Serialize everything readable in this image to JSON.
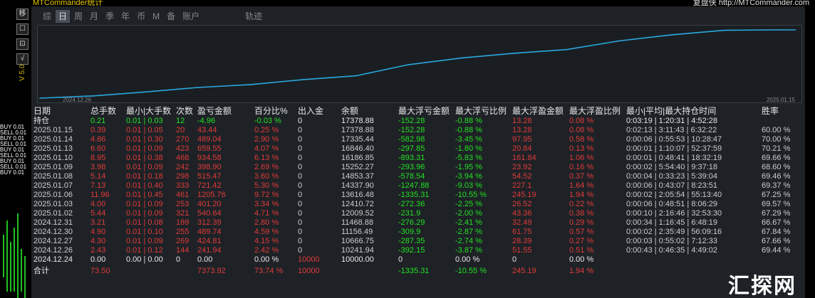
{
  "window": {
    "app_title": "MTCommander统计",
    "copyright": "复盘侠 http://MTCommander.com"
  },
  "left_strip": {
    "version": "V 5.05",
    "ticks": [
      "BUY 0.01",
      "SELL 0.01",
      "BUY 0.01",
      "SELL 0.01",
      "BUY 0.01",
      "SELL 0.01",
      "BUY 0.01",
      "SELL 0.01",
      "BUY 0.01"
    ]
  },
  "side_buttons": [
    {
      "label": "移",
      "name": "move-icon"
    },
    {
      "label": "☐",
      "name": "window-icon"
    },
    {
      "label": "⊡",
      "name": "layout-icon"
    },
    {
      "label": "√",
      "name": "check-icon"
    }
  ],
  "tabs": [
    {
      "label": "综",
      "active": false
    },
    {
      "label": "日",
      "active": true
    },
    {
      "label": "周",
      "active": false
    },
    {
      "label": "月",
      "active": false
    },
    {
      "label": "季",
      "active": false
    },
    {
      "label": "年",
      "active": false
    },
    {
      "label": "币",
      "active": false
    },
    {
      "label": "M",
      "active": false
    },
    {
      "label": "备",
      "active": false
    },
    {
      "label": "账户",
      "active": false
    },
    {
      "label": "轨迹",
      "active": false
    }
  ],
  "chart": {
    "start_date": "2024.12.26",
    "end_date": "2025.01.15",
    "line_color": "#2aa7e0"
  },
  "chart_data": {
    "type": "line",
    "x": [
      "2024.12.24",
      "2024.12.26",
      "2024.12.27",
      "2024.12.30",
      "2024.12.31",
      "2025.01.02",
      "2025.01.03",
      "2025.01.06",
      "2025.01.07",
      "2025.01.08",
      "2025.01.09",
      "2025.01.10",
      "2025.01.13",
      "2025.01.14",
      "2025.01.15"
    ],
    "values": [
      10000.0,
      10241.94,
      10666.75,
      11156.49,
      11468.88,
      12009.52,
      12410.72,
      13616.48,
      14337.9,
      14853.37,
      15252.27,
      16186.85,
      16846.4,
      17335.44,
      17378.88
    ],
    "ylabel": "",
    "xlabel": ""
  },
  "table": {
    "headers": [
      "日期",
      "总手数",
      "最小|大手数",
      "次数",
      "盈亏金额",
      "百分比%",
      "出入金",
      "余额",
      "最大浮亏金额",
      "最大浮亏比例",
      "最大浮盈金额",
      "最大浮盈比例",
      "最小|平均|最大持仓时间",
      "胜率"
    ],
    "holding": {
      "date": "持仓",
      "lots": "0.21",
      "minmax": "0.01 | 0.03",
      "count": "12",
      "pnl": "-4.96",
      "pct": "-0.03 %",
      "inout": "0",
      "balance": "17378.88",
      "mfl": "-152.28",
      "mflp": "-0.88 %",
      "mfp": "13.28",
      "mfpp": "0.08 %",
      "time": "0:03:19 | 1:20:31 | 4:52:28",
      "win": ""
    },
    "rows": [
      {
        "date": "2025.01.15",
        "lots": "0.39",
        "minmax": "0.01 | 0.05",
        "count": "20",
        "pnl": "43.44",
        "pct": "0.25 %",
        "inout": "0",
        "balance": "17378.88",
        "mfl": "-152.28",
        "mflp": "-0.88 %",
        "mfp": "13.28",
        "mfpp": "0.08 %",
        "time": "0:02:13 | 3:11:43 | 6:32:22",
        "win": "60.00 %"
      },
      {
        "date": "2025.01.14",
        "lots": "4.86",
        "minmax": "0.01 | 0.30",
        "count": "270",
        "pnl": "489.04",
        "pct": "2.90 %",
        "inout": "0",
        "balance": "17335.44",
        "mfl": "-582.98",
        "mflp": "-3.45 %",
        "mfp": "97.95",
        "mfpp": "0.58 %",
        "time": "0:00:06 | 0:55:53 | 10:28:47",
        "win": "70.00 %"
      },
      {
        "date": "2025.01.13",
        "lots": "6.60",
        "minmax": "0.01 | 0.09",
        "count": "423",
        "pnl": "659.55",
        "pct": "4.07 %",
        "inout": "0",
        "balance": "16846.40",
        "mfl": "-297.85",
        "mflp": "-1.80 %",
        "mfp": "20.84",
        "mfpp": "0.13 %",
        "time": "0:00:01 | 1:10:07 | 52:37:59",
        "win": "70.21 %"
      },
      {
        "date": "2025.01.10",
        "lots": "8.95",
        "minmax": "0.01 | 0.38",
        "count": "468",
        "pnl": "934.58",
        "pct": "6.13 %",
        "inout": "0",
        "balance": "16186.85",
        "mfl": "-893.31",
        "mflp": "-5.83 %",
        "mfp": "161.84",
        "mfpp": "1.06 %",
        "time": "0:00:01 | 0:48:41 | 18:32:19",
        "win": "69.66 %"
      },
      {
        "date": "2025.01.09",
        "lots": "3.98",
        "minmax": "0.01 | 0.09",
        "count": "242",
        "pnl": "398.90",
        "pct": "2.69 %",
        "inout": "0",
        "balance": "15252.27",
        "mfl": "-293.96",
        "mflp": "-1.95 %",
        "mfp": "23.92",
        "mfpp": "0.16 %",
        "time": "0:00:02 | 5:54:40 | 9:37:18",
        "win": "68.60 %"
      },
      {
        "date": "2025.01.08",
        "lots": "5.14",
        "minmax": "0.01 | 0.18",
        "count": "298",
        "pnl": "515.47",
        "pct": "3.60 %",
        "inout": "0",
        "balance": "14853.37",
        "mfl": "-578.54",
        "mflp": "-3.94 %",
        "mfp": "54.52",
        "mfpp": "0.37 %",
        "time": "0:00:04 | 0:33:23 | 5:39:04",
        "win": "69.46 %"
      },
      {
        "date": "2025.01.07",
        "lots": "7.13",
        "minmax": "0.01 | 0.40",
        "count": "333",
        "pnl": "721.42",
        "pct": "5.30 %",
        "inout": "0",
        "balance": "14337.90",
        "mfl": "-1247.88",
        "mflp": "-9.03 %",
        "mfp": "227.1",
        "mfpp": "1.64 %",
        "time": "0:00:06 | 0:43:07 | 8:23:51",
        "win": "69.37 %"
      },
      {
        "date": "2025.01.06",
        "lots": "11.96",
        "minmax": "0.01 | 0.45",
        "count": "461",
        "pnl": "1205.76",
        "pct": "9.72 %",
        "inout": "0",
        "balance": "13616.48",
        "mfl": "-1335.31",
        "mflp": "-10.55 %",
        "mfp": "245.19",
        "mfpp": "1.94 %",
        "time": "0:00:02 | 2:05:54 | 55:13:40",
        "win": "67.25 %"
      },
      {
        "date": "2025.01.03",
        "lots": "4.00",
        "minmax": "0.01 | 0.09",
        "count": "253",
        "pnl": "401.20",
        "pct": "3.34 %",
        "inout": "0",
        "balance": "12410.72",
        "mfl": "-272.36",
        "mflp": "-2.25 %",
        "mfp": "26.52",
        "mfpp": "0.22 %",
        "time": "0:00:06 | 0:48:51 | 8:06:29",
        "win": "69.57 %"
      },
      {
        "date": "2025.01.02",
        "lots": "5.44",
        "minmax": "0.01 | 0.09",
        "count": "321",
        "pnl": "540.64",
        "pct": "4.71 %",
        "inout": "0",
        "balance": "12009.52",
        "mfl": "-231.9",
        "mflp": "-2.00 %",
        "mfp": "43.36",
        "mfpp": "0.38 %",
        "time": "0:00:10 | 2:16:46 | 32:53:30",
        "win": "67.29 %"
      },
      {
        "date": "2024.12.31",
        "lots": "3.21",
        "minmax": "0.01 | 0.08",
        "count": "189",
        "pnl": "312.39",
        "pct": "2.80 %",
        "inout": "0",
        "balance": "11468.88",
        "mfl": "-276.29",
        "mflp": "-2.41 %",
        "mfp": "32.49",
        "mfpp": "0.29 %",
        "time": "0:00:34 | 1:16:45 | 6:48:19",
        "win": "66.67 %"
      },
      {
        "date": "2024.12.30",
        "lots": "4.90",
        "minmax": "0.01 | 0.10",
        "count": "255",
        "pnl": "489.74",
        "pct": "4.59 %",
        "inout": "0",
        "balance": "11156.49",
        "mfl": "-309.9",
        "mflp": "-2.87 %",
        "mfp": "61.75",
        "mfpp": "0.57 %",
        "time": "0:00:02 | 2:35:49 | 56:09:16",
        "win": "67.84 %"
      },
      {
        "date": "2024.12.27",
        "lots": "4.30",
        "minmax": "0.01 | 0.09",
        "count": "269",
        "pnl": "424.81",
        "pct": "4.15 %",
        "inout": "0",
        "balance": "10666.75",
        "mfl": "-287.35",
        "mflp": "-2.74 %",
        "mfp": "28.39",
        "mfpp": "0.27 %",
        "time": "0:00:03 | 0:55:02 | 7:12:33",
        "win": "67.66 %"
      },
      {
        "date": "2024.12.26",
        "lots": "2.43",
        "minmax": "0.01 | 0.12",
        "count": "144",
        "pnl": "241.94",
        "pct": "2.42 %",
        "inout": "0",
        "balance": "10241.94",
        "mfl": "-392.15",
        "mflp": "-3.87 %",
        "mfp": "51.55",
        "mfpp": "0.51 %",
        "time": "0:00:43 | 0:46:35 | 4:49:02",
        "win": "69.44 %"
      },
      {
        "date": "2024.12.24",
        "lots": "0.00",
        "minmax": "0.00 | 0.00",
        "count": "0",
        "pnl": "0.00",
        "pct": "0.00 %",
        "inout": "10000",
        "balance": "10000.00",
        "mfl": "0",
        "mflp": "0.00 %",
        "mfp": "0",
        "mfpp": "0.00 %",
        "time": "",
        "win": ""
      }
    ],
    "total": {
      "date": "合计",
      "lots": "73.50",
      "minmax": "",
      "count": "",
      "pnl": "7373.92",
      "pct": "73.74 %",
      "inout": "10000",
      "balance": "",
      "mfl": "-1335.31",
      "mflp": "-10.55 %",
      "mfp": "245.19",
      "mfpp": "1.94 %",
      "time": "",
      "win": ""
    }
  },
  "colors": {
    "loss": "#e03a3a",
    "gain": "#22e022",
    "text": "#e8e8e8",
    "accent": "#2aa7e0"
  },
  "watermark": "汇探网"
}
